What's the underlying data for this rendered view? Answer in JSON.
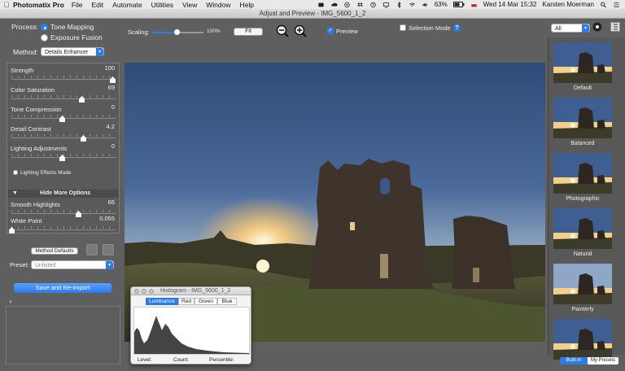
{
  "menubar": {
    "app_name": "Photomatix Pro",
    "items": [
      "File",
      "Edit",
      "Automate",
      "Utilities",
      "View",
      "Window",
      "Help"
    ],
    "battery": "63%",
    "datetime": "Wed 14 Mar  15:32",
    "user": "Karsten Moerman"
  },
  "window": {
    "title": "Adjust and Preview - IMG_5600_1_2"
  },
  "toolbar": {
    "process_label": "Process:",
    "tone_mapping": "Tone Mapping",
    "exposure_fusion": "Exposure Fusion",
    "method_label": "Method:",
    "method_value": "Details Enhancer",
    "scaling_label": "Scaling:",
    "scaling_value": "100%",
    "fit_label": "Fit",
    "preview_label": "Preview",
    "selection_mode_label": "Selection Mode",
    "help_icon_text": "?",
    "filter_value": "All"
  },
  "sliders": [
    {
      "label": "Strength",
      "value": "100",
      "level": 1.0
    },
    {
      "label": "Color Saturation",
      "value": "69",
      "level": 0.69
    },
    {
      "label": "Tone Compression",
      "value": "0",
      "level": 0.5
    },
    {
      "label": "Detail Contrast",
      "value": "4.2",
      "level": 0.71
    },
    {
      "label": "Lighting Adjustments",
      "value": "0",
      "level": 0.5
    }
  ],
  "lighting_effects_label": "Lighting Effects Mode",
  "more_options_label": "Hide More Options",
  "more_sliders": [
    {
      "label": "Smooth Highlights",
      "value": "66",
      "level": 0.66
    },
    {
      "label": "White Point",
      "value": "0.055",
      "level": 0.0
    }
  ],
  "method_defaults_label": "Method Defaults",
  "preset_label": "Preset:",
  "preset_value": "Unlisted",
  "save_reimport_label": "Save and Re-import",
  "presets": [
    "Default",
    "Balanced",
    "Photographic",
    "Natural",
    "Painterly",
    ""
  ],
  "preset_tabs": [
    "Built-In",
    "My Presets"
  ],
  "histogram": {
    "title": "Histogram - IMG_5600_1_2",
    "tabs": [
      "Luminance",
      "Red",
      "Green",
      "Blue"
    ],
    "level_label": "Level:",
    "count_label": "Count:",
    "percentile_label": "Percentile:"
  }
}
